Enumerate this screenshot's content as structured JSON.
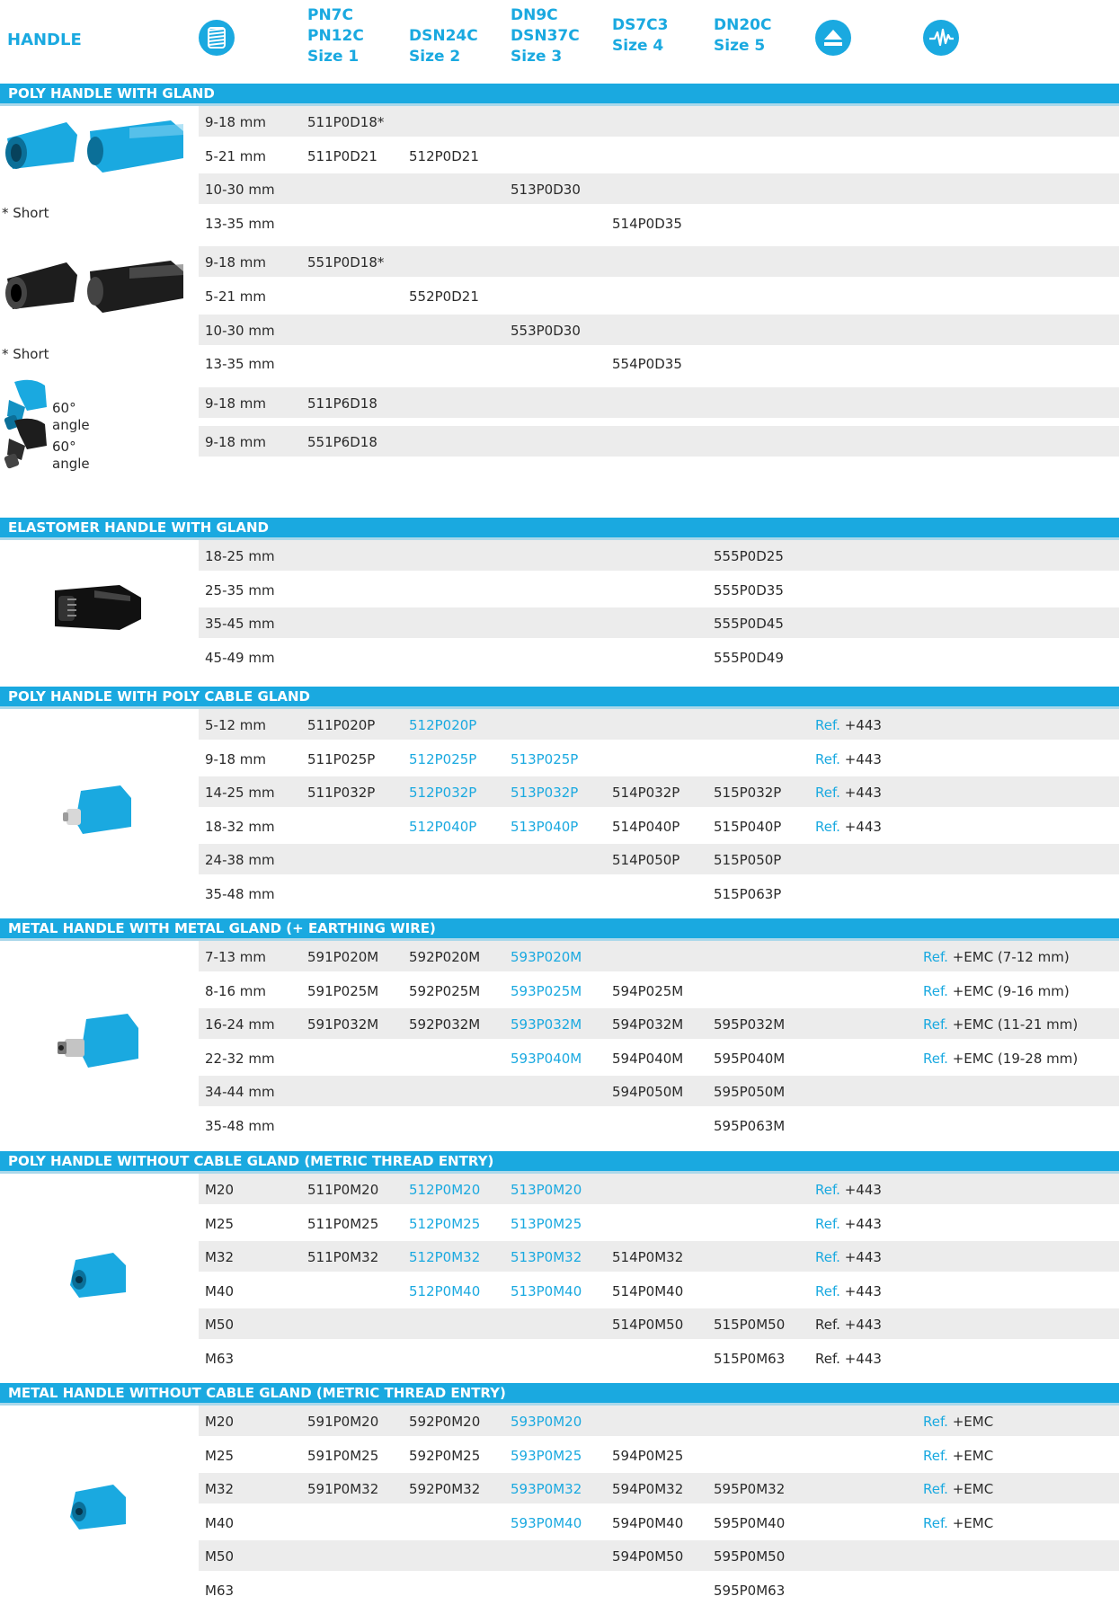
{
  "header": {
    "handle_label": "HANDLE",
    "columns": [
      [
        "PN7C",
        "PN12C",
        "Size 1"
      ],
      [
        "DSN24C",
        "Size 2"
      ],
      [
        "DN9C",
        "DSN37C",
        "Size 3"
      ],
      [
        "DS7C3",
        "Size 4"
      ],
      [
        "DN20C",
        "Size 5"
      ]
    ],
    "icons": [
      "thread-icon",
      "eject-icon",
      "emc-wave-icon"
    ]
  },
  "colors": {
    "accent": "#1aa9e0",
    "row_shade": "#ececec",
    "text": "#2a2a2a"
  },
  "sections": [
    {
      "title": "POLY HANDLE WITH GLAND",
      "groups": [
        {
          "note": "* Short",
          "image": "blue-straight-handles",
          "rows": [
            {
              "range": "9-18 mm",
              "cells": [
                "511P0D18*",
                "",
                "",
                "",
                "",
                "",
                ""
              ]
            },
            {
              "range": "5-21 mm",
              "cells": [
                "511P0D21",
                "512P0D21",
                "",
                "",
                "",
                "",
                ""
              ]
            },
            {
              "range": "10-30 mm",
              "cells": [
                "",
                "",
                "513P0D30",
                "",
                "",
                "",
                ""
              ]
            },
            {
              "range": "13-35 mm",
              "cells": [
                "",
                "",
                "",
                "514P0D35",
                "",
                "",
                ""
              ]
            }
          ]
        },
        {
          "note": "* Short",
          "image": "black-straight-handles",
          "rows": [
            {
              "range": "9-18 mm",
              "cells": [
                "551P0D18*",
                "",
                "",
                "",
                "",
                "",
                ""
              ]
            },
            {
              "range": "5-21 mm",
              "cells": [
                "",
                "552P0D21",
                "",
                "",
                "",
                "",
                ""
              ]
            },
            {
              "range": "10-30 mm",
              "cells": [
                "",
                "",
                "553P0D30",
                "",
                "",
                "",
                ""
              ]
            },
            {
              "range": "13-35 mm",
              "cells": [
                "",
                "",
                "",
                "554P0D35",
                "",
                "",
                ""
              ]
            }
          ]
        },
        {
          "note": "60° angle",
          "image": "blue-angled-handle",
          "rows": [
            {
              "range": "9-18 mm",
              "cells": [
                "511P6D18",
                "",
                "",
                "",
                "",
                "",
                ""
              ]
            }
          ]
        },
        {
          "note": "60° angle",
          "image": "black-angled-handle",
          "rows": [
            {
              "range": "9-18 mm",
              "cells": [
                "551P6D18",
                "",
                "",
                "",
                "",
                "",
                ""
              ]
            }
          ]
        }
      ]
    },
    {
      "title": "ELASTOMER HANDLE WITH GLAND",
      "groups": [
        {
          "note": "",
          "image": "black-elastomer-handle",
          "rows": [
            {
              "range": "18-25 mm",
              "cells": [
                "",
                "",
                "",
                "",
                "555P0D25",
                "",
                ""
              ]
            },
            {
              "range": "25-35 mm",
              "cells": [
                "",
                "",
                "",
                "",
                "555P0D35",
                "",
                ""
              ]
            },
            {
              "range": "35-45 mm",
              "cells": [
                "",
                "",
                "",
                "",
                "555P0D45",
                "",
                ""
              ]
            },
            {
              "range": "45-49 mm",
              "cells": [
                "",
                "",
                "",
                "",
                "555P0D49",
                "",
                ""
              ]
            }
          ]
        }
      ]
    },
    {
      "title": "POLY HANDLE WITH POLY CABLE GLAND",
      "groups": [
        {
          "note": "",
          "image": "blue-handle-poly-gland",
          "rows": [
            {
              "range": "5-12 mm",
              "cells": [
                "511P020P",
                "512P020P",
                "",
                "",
                "",
                "Ref. +443",
                ""
              ],
              "blue": [
                1
              ]
            },
            {
              "range": "9-18 mm",
              "cells": [
                "511P025P",
                "512P025P",
                "513P025P",
                "",
                "",
                "Ref. +443",
                ""
              ],
              "blue": [
                1,
                2
              ]
            },
            {
              "range": "14-25 mm",
              "cells": [
                "511P032P",
                "512P032P",
                "513P032P",
                "514P032P",
                "515P032P",
                "Ref. +443",
                ""
              ],
              "blue": [
                1,
                2
              ]
            },
            {
              "range": "18-32 mm",
              "cells": [
                "",
                "512P040P",
                "513P040P",
                "514P040P",
                "515P040P",
                "Ref. +443",
                ""
              ],
              "blue": [
                1,
                2
              ]
            },
            {
              "range": "24-38 mm",
              "cells": [
                "",
                "",
                "",
                "514P050P",
                "515P050P",
                "",
                ""
              ]
            },
            {
              "range": "35-48 mm",
              "cells": [
                "",
                "",
                "",
                "",
                "515P063P",
                "",
                ""
              ]
            }
          ]
        }
      ]
    },
    {
      "title": "METAL HANDLE WITH METAL GLAND (+ EARTHING WIRE)",
      "groups": [
        {
          "note": "",
          "image": "blue-handle-metal-gland",
          "rows": [
            {
              "range": "7-13 mm",
              "cells": [
                "591P020M",
                "592P020M",
                "593P020M",
                "",
                "",
                "",
                "Ref. +EMC (7-12 mm)"
              ],
              "blue": [
                2
              ]
            },
            {
              "range": "8-16 mm",
              "cells": [
                "591P025M",
                "592P025M",
                "593P025M",
                "594P025M",
                "",
                "",
                "Ref. +EMC (9-16 mm)"
              ],
              "blue": [
                2
              ]
            },
            {
              "range": "16-24 mm",
              "cells": [
                "591P032M",
                "592P032M",
                "593P032M",
                "594P032M",
                "595P032M",
                "",
                "Ref. +EMC (11-21 mm)"
              ],
              "blue": [
                2
              ]
            },
            {
              "range": "22-32 mm",
              "cells": [
                "",
                "",
                "593P040M",
                "594P040M",
                "595P040M",
                "",
                "Ref. +EMC (19-28 mm)"
              ],
              "blue": [
                2
              ]
            },
            {
              "range": "34-44 mm",
              "cells": [
                "",
                "",
                "",
                "594P050M",
                "595P050M",
                "",
                ""
              ]
            },
            {
              "range": "35-48 mm",
              "cells": [
                "",
                "",
                "",
                "",
                "595P063M",
                "",
                ""
              ]
            }
          ]
        }
      ]
    },
    {
      "title": "POLY HANDLE WITHOUT CABLE GLAND (METRIC THREAD ENTRY)",
      "groups": [
        {
          "note": "",
          "image": "blue-handle-thread-entry",
          "rows": [
            {
              "range": "M20",
              "cells": [
                "511P0M20",
                "512P0M20",
                "513P0M20",
                "",
                "",
                "Ref. +443",
                ""
              ],
              "blue": [
                1,
                2
              ]
            },
            {
              "range": "M25",
              "cells": [
                "511P0M25",
                "512P0M25",
                "513P0M25",
                "",
                "",
                "Ref. +443",
                ""
              ],
              "blue": [
                1,
                2
              ]
            },
            {
              "range": "M32",
              "cells": [
                "511P0M32",
                "512P0M32",
                "513P0M32",
                "514P0M32",
                "",
                "Ref. +443",
                ""
              ],
              "blue": [
                1,
                2
              ]
            },
            {
              "range": "M40",
              "cells": [
                "",
                "512P0M40",
                "513P0M40",
                "514P0M40",
                "",
                "Ref. +443",
                ""
              ],
              "blue": [
                1,
                2
              ]
            },
            {
              "range": "M50",
              "cells": [
                "",
                "",
                "",
                "514P0M50",
                "515P0M50",
                "Ref. +443",
                ""
              ],
              "plainref": true
            },
            {
              "range": "M63",
              "cells": [
                "",
                "",
                "",
                "",
                "515P0M63",
                "Ref. +443",
                ""
              ],
              "plainref": true
            }
          ]
        }
      ]
    },
    {
      "title": "METAL HANDLE WITHOUT CABLE GLAND (METRIC THREAD ENTRY)",
      "groups": [
        {
          "note": "",
          "image": "blue-metal-handle-thread-entry",
          "rows": [
            {
              "range": "M20",
              "cells": [
                "591P0M20",
                "592P0M20",
                "593P0M20",
                "",
                "",
                "",
                "Ref. +EMC"
              ],
              "blue": [
                2
              ]
            },
            {
              "range": "M25",
              "cells": [
                "591P0M25",
                "592P0M25",
                "593P0M25",
                "594P0M25",
                "",
                "",
                "Ref. +EMC"
              ],
              "blue": [
                2
              ]
            },
            {
              "range": "M32",
              "cells": [
                "591P0M32",
                "592P0M32",
                "593P0M32",
                "594P0M32",
                "595P0M32",
                "",
                "Ref. +EMC"
              ],
              "blue": [
                2
              ]
            },
            {
              "range": "M40",
              "cells": [
                "",
                "",
                "593P0M40",
                "594P0M40",
                "595P0M40",
                "",
                "Ref. +EMC"
              ],
              "blue": [
                2
              ]
            },
            {
              "range": "M50",
              "cells": [
                "",
                "",
                "",
                "594P0M50",
                "595P0M50",
                "",
                ""
              ]
            },
            {
              "range": "M63",
              "cells": [
                "",
                "",
                "",
                "",
                "595P0M63",
                "",
                ""
              ]
            }
          ]
        }
      ]
    }
  ]
}
